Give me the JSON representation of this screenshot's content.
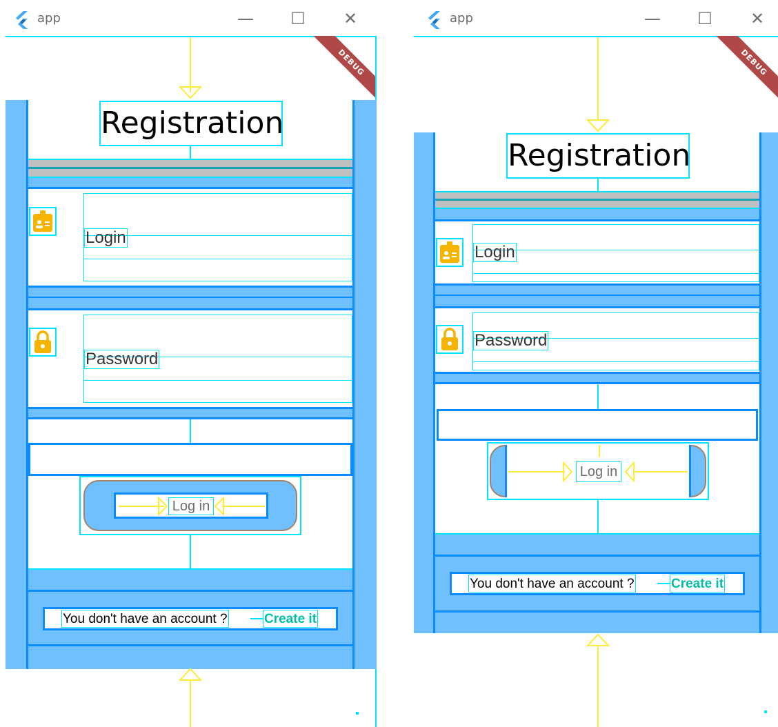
{
  "windows": [
    {
      "app_title": "app",
      "debug_banner": "DEBUG",
      "page_title": "Registration",
      "login_label": "Login",
      "password_label": "Password",
      "login_button": "Log in",
      "signup_text": "You don't have an account ?",
      "signup_link": "Create it"
    },
    {
      "app_title": "app",
      "debug_banner": "DEBUG",
      "page_title": "Registration",
      "login_label": "Login",
      "password_label": "Password",
      "login_button": "Log in",
      "signup_text": "You don't have an account ?",
      "signup_link": "Create it"
    }
  ],
  "window_controls": {
    "minimize": "—",
    "maximize": "☐",
    "close": "✕"
  },
  "icons": {
    "login_field": "badge-icon",
    "password_field": "lock-icon",
    "app": "flutter-logo-icon"
  },
  "colors": {
    "debug_overlay": "#00e5ff",
    "padding_fill": "#70bfff",
    "container_border": "#0a8cff",
    "icon": "#f5b400",
    "link": "#00bfa5",
    "ribbon": "#b04848",
    "arrows": "#ffeb3b"
  }
}
